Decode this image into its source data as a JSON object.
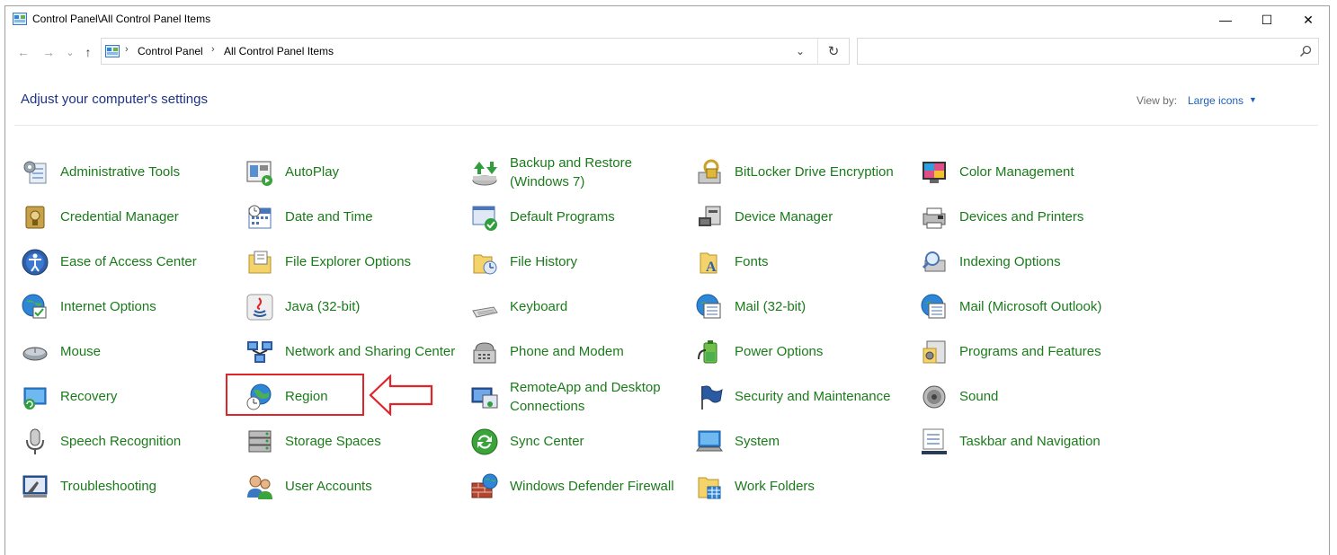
{
  "window": {
    "title": "Control Panel\\All Control Panel Items",
    "minimize": "—",
    "maximize": "☐",
    "close": "✕"
  },
  "nav": {
    "back": "←",
    "forward": "→",
    "recent": "⌄",
    "up": "↑"
  },
  "address": {
    "sep": "›",
    "crumbs": [
      "Control Panel",
      "All Control Panel Items"
    ],
    "dropdown": "⌄",
    "refresh": "↻"
  },
  "search": {
    "value": "",
    "placeholder": ""
  },
  "header": {
    "heading": "Adjust your computer's settings",
    "view_by_label": "View by:",
    "view_by_value": "Large icons",
    "caret": "▼"
  },
  "items": [
    {
      "label": "Administrative Tools",
      "icon": "admin-tools-icon"
    },
    {
      "label": "AutoPlay",
      "icon": "autoplay-icon"
    },
    {
      "label": "Backup and Restore (Windows 7)",
      "icon": "backup-restore-icon"
    },
    {
      "label": "BitLocker Drive Encryption",
      "icon": "bitlocker-icon"
    },
    {
      "label": "Color Management",
      "icon": "color-management-icon"
    },
    {
      "label": "Credential Manager",
      "icon": "credential-manager-icon"
    },
    {
      "label": "Date and Time",
      "icon": "date-time-icon"
    },
    {
      "label": "Default Programs",
      "icon": "default-programs-icon"
    },
    {
      "label": "Device Manager",
      "icon": "device-manager-icon"
    },
    {
      "label": "Devices and Printers",
      "icon": "devices-printers-icon"
    },
    {
      "label": "Ease of Access Center",
      "icon": "ease-of-access-icon"
    },
    {
      "label": "File Explorer Options",
      "icon": "file-explorer-options-icon"
    },
    {
      "label": "File History",
      "icon": "file-history-icon"
    },
    {
      "label": "Fonts",
      "icon": "fonts-icon"
    },
    {
      "label": "Indexing Options",
      "icon": "indexing-options-icon"
    },
    {
      "label": "Internet Options",
      "icon": "internet-options-icon"
    },
    {
      "label": "Java (32-bit)",
      "icon": "java-icon"
    },
    {
      "label": "Keyboard",
      "icon": "keyboard-icon"
    },
    {
      "label": "Mail (32-bit)",
      "icon": "mail-icon"
    },
    {
      "label": "Mail (Microsoft Outlook)",
      "icon": "mail-outlook-icon"
    },
    {
      "label": "Mouse",
      "icon": "mouse-icon"
    },
    {
      "label": "Network and Sharing Center",
      "icon": "network-sharing-icon"
    },
    {
      "label": "Phone and Modem",
      "icon": "phone-modem-icon"
    },
    {
      "label": "Power Options",
      "icon": "power-options-icon"
    },
    {
      "label": "Programs and Features",
      "icon": "programs-features-icon"
    },
    {
      "label": "Recovery",
      "icon": "recovery-icon"
    },
    {
      "label": "Region",
      "icon": "region-icon"
    },
    {
      "label": "RemoteApp and Desktop Connections",
      "icon": "remoteapp-icon"
    },
    {
      "label": "Security and Maintenance",
      "icon": "security-maintenance-icon"
    },
    {
      "label": "Sound",
      "icon": "sound-icon"
    },
    {
      "label": "Speech Recognition",
      "icon": "speech-recognition-icon"
    },
    {
      "label": "Storage Spaces",
      "icon": "storage-spaces-icon"
    },
    {
      "label": "Sync Center",
      "icon": "sync-center-icon"
    },
    {
      "label": "System",
      "icon": "system-icon"
    },
    {
      "label": "Taskbar and Navigation",
      "icon": "taskbar-navigation-icon"
    },
    {
      "label": "Troubleshooting",
      "icon": "troubleshooting-icon"
    },
    {
      "label": "User Accounts",
      "icon": "user-accounts-icon"
    },
    {
      "label": "Windows Defender Firewall",
      "icon": "firewall-icon"
    },
    {
      "label": "Work Folders",
      "icon": "work-folders-icon"
    }
  ],
  "colors": {
    "item_text": "#1b7a1b",
    "heading": "#1e3287",
    "link": "#1e5fb4",
    "annotation": "#e0242a"
  }
}
